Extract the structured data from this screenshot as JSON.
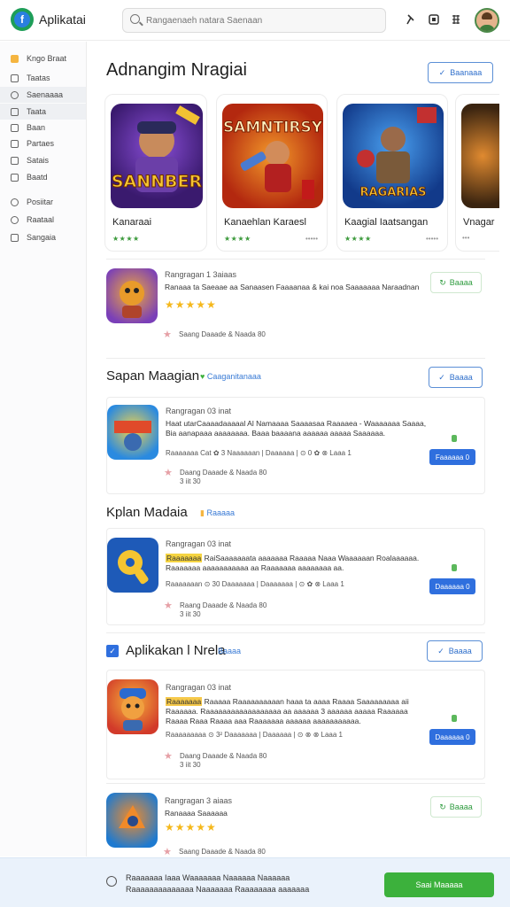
{
  "header": {
    "brand": "Aplikatai",
    "search_placeholder": "Rangaenaeh natara Saenaan"
  },
  "sidebar": {
    "items": [
      {
        "label": "Kngo Braat"
      },
      {
        "label": "Taatas"
      },
      {
        "label": "Saenaaaa"
      },
      {
        "label": "Taata"
      },
      {
        "label": "Baan"
      },
      {
        "label": "Partaes"
      },
      {
        "label": "Satais"
      },
      {
        "label": "Baatd"
      },
      {
        "label": "Posiitar"
      },
      {
        "label": "Raataal"
      },
      {
        "label": "Sangaia"
      }
    ]
  },
  "featured": {
    "title": "Adnangim Nragiai",
    "button": "Baanaaa",
    "cards": [
      {
        "name": "Kanaraai",
        "art_text": "SANNBER",
        "rating": "★★★★",
        "extra": ""
      },
      {
        "name": "Kanaehlan Karaesl",
        "art_text": "SAMNTIRSY",
        "rating": "★★★★",
        "extra": "•••••"
      },
      {
        "name": "Kaagial Iaatsangan",
        "art_text": "RAGARIAS",
        "rating": "★★★★",
        "extra": "•••••"
      },
      {
        "name": "Vnagar",
        "art_text": "",
        "rating": "",
        "extra": "•••"
      }
    ]
  },
  "top_item": {
    "title": "Rangragan 1 3aiaas",
    "desc": "Ranaaa ta Saeaae aa Sanaasen Faaaanaa & kai noa Saaaaaaa Naraadnan",
    "stars": "★★★★★",
    "sub": "Saang Daaade & Naada 80",
    "button": "Baaaa"
  },
  "section2": {
    "title": "Sapan Maagian",
    "link": "Caaganitanaaa",
    "button": "Baaaa",
    "item": {
      "title": "Rangragan 03 inat",
      "desc": "Haat utarCaaaadaaaaal Al Namaaaa Saaaasaa Raaaaea - Waaaaaaa Saaaa, Bia  aanapaaa aaaaaaaa. Baaa baaaana aaaaaa aaaaa Saaaaaa.",
      "meta": "Raaaaaaa  Cat  ✿  3   Naaaaaan  |  Daaaaaa  |  ⊙ 0 ✿ ⊗  Laaa 1",
      "sub1": "Daang Daaade & Naada 80",
      "sub2": "3 iit 30",
      "button": "Faaaaaa 0"
    }
  },
  "section3": {
    "title": "Kplan Madaia",
    "link": "Raaaaa",
    "item": {
      "title": "Rangragan 03 inat",
      "highlight": "Raaaaaaa",
      "desc": "RaiSaaaaaaata aaaaaaa Raaaaa Naaa Waaaaaan Roalaaaaaa. Raaaaaaa aaaaaaaaaaa aa Raaaaaaa aaaaaaaa aa.",
      "meta": "Raaaaaaan  ⊙ 30  Daaaaaaa  |  Daaaaaaa  |  ⊙ ✿ ⊗  Laaa 1",
      "sub1": "Raang Daaade & Naada 80",
      "sub2": "3 iit 30",
      "button": "Daaaaaa 0"
    }
  },
  "section4": {
    "title": "Aplikakan l Nrela",
    "link": "Baaaa",
    "button": "Baaaa",
    "item": {
      "title": "Rangragan 03 inat",
      "highlight": "Raaaaaaa",
      "desc": "Raaaaa Raaaaaaaaaan haaa ta aaaa Raaaa Saaaaaaaaa aii Raaaaaa. Raaaaaaaaaaaaaaaaaa aa aaaaaa 3 aaaaaa aaaaa Raaaaaa Raaaa Raaa Raaaa aaa Raaaaaaa aaaaaa aaaaaaaaaaa.",
      "meta": "Raaaaaaaaa  ⊙ 3²  Daaaaaaa  |  Daaaaaa  |  ⊙ ⊗ ⊗  Laaa 1",
      "sub1": "Daang Daaade & Naada 80",
      "sub2": "3 iit 30",
      "button": "Daaaaaa 0"
    }
  },
  "bottom_item": {
    "title": "Rangragan 3 aiaas",
    "desc": "Ranaaaa Saaaaaa",
    "stars": "★★★★★",
    "sub": "Saang Daaade & Naada 80",
    "button": "Baaaa"
  },
  "footer": {
    "text": "Raaaaaaa Iaaa Waaaaaaa Naaaaaa Naaaaaa Raaaaaaaaaaaaaa Naaaaaaa Raaaaaaaa aaaaaaa",
    "button": "Saai Maaaaa"
  }
}
